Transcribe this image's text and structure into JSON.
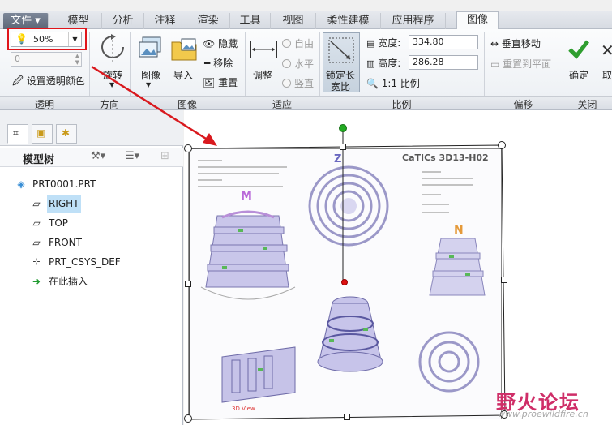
{
  "menu": {
    "file": "文件",
    "tabs": [
      "模型",
      "分析",
      "注释",
      "渲染",
      "工具",
      "视图",
      "柔性建模",
      "应用程序",
      "图像"
    ]
  },
  "transparency": {
    "opacity_value": "50%",
    "spin_value": "0",
    "set_color_label": "设置透明颜色",
    "group_label": "透明"
  },
  "direction": {
    "rotate_label": "旋转",
    "group_label": "方向"
  },
  "image_group": {
    "image_label": "图像",
    "import_label": "导入",
    "hide_label": "隐藏",
    "remove_label": "移除",
    "reset_label": "重置",
    "group_label": "图像"
  },
  "fit": {
    "adjust_label": "调整",
    "free_label": "自由",
    "horizontal_label": "水平",
    "vertical_label": "竖直",
    "group_label": "适应"
  },
  "scale": {
    "lock_label_1": "锁定长",
    "lock_label_2": "宽比",
    "width_label": "宽度:",
    "width_value": "334.80",
    "height_label": "高度:",
    "height_value": "286.28",
    "ratio_label": "1:1 比例",
    "group_label": "比例"
  },
  "offset": {
    "vertical_move_label": "垂直移动",
    "reset_plane_label": "重置到平面",
    "group_label": "偏移"
  },
  "close": {
    "ok_label": "确定",
    "cancel_label": "取",
    "group_label": "关闭"
  },
  "model_tree": {
    "title": "模型树",
    "items": [
      {
        "label": "PRT0001.PRT"
      },
      {
        "label": "RIGHT"
      },
      {
        "label": "TOP"
      },
      {
        "label": "FRONT"
      },
      {
        "label": "PRT_CSYS_DEF"
      },
      {
        "label": "在此插入"
      }
    ]
  },
  "image_content": {
    "header": "CaTICs 3D13-H02",
    "label_m": "M",
    "label_n": "N",
    "label_z": "Z",
    "view_caption": "3D View"
  },
  "watermark": {
    "text": "野火论坛",
    "url": "www.proewildfire.cn"
  },
  "colors": {
    "accent_red": "#e0151b",
    "handle_green": "#22aa22",
    "pivot_red": "#dd1111",
    "watermark": "#cf2e68"
  }
}
